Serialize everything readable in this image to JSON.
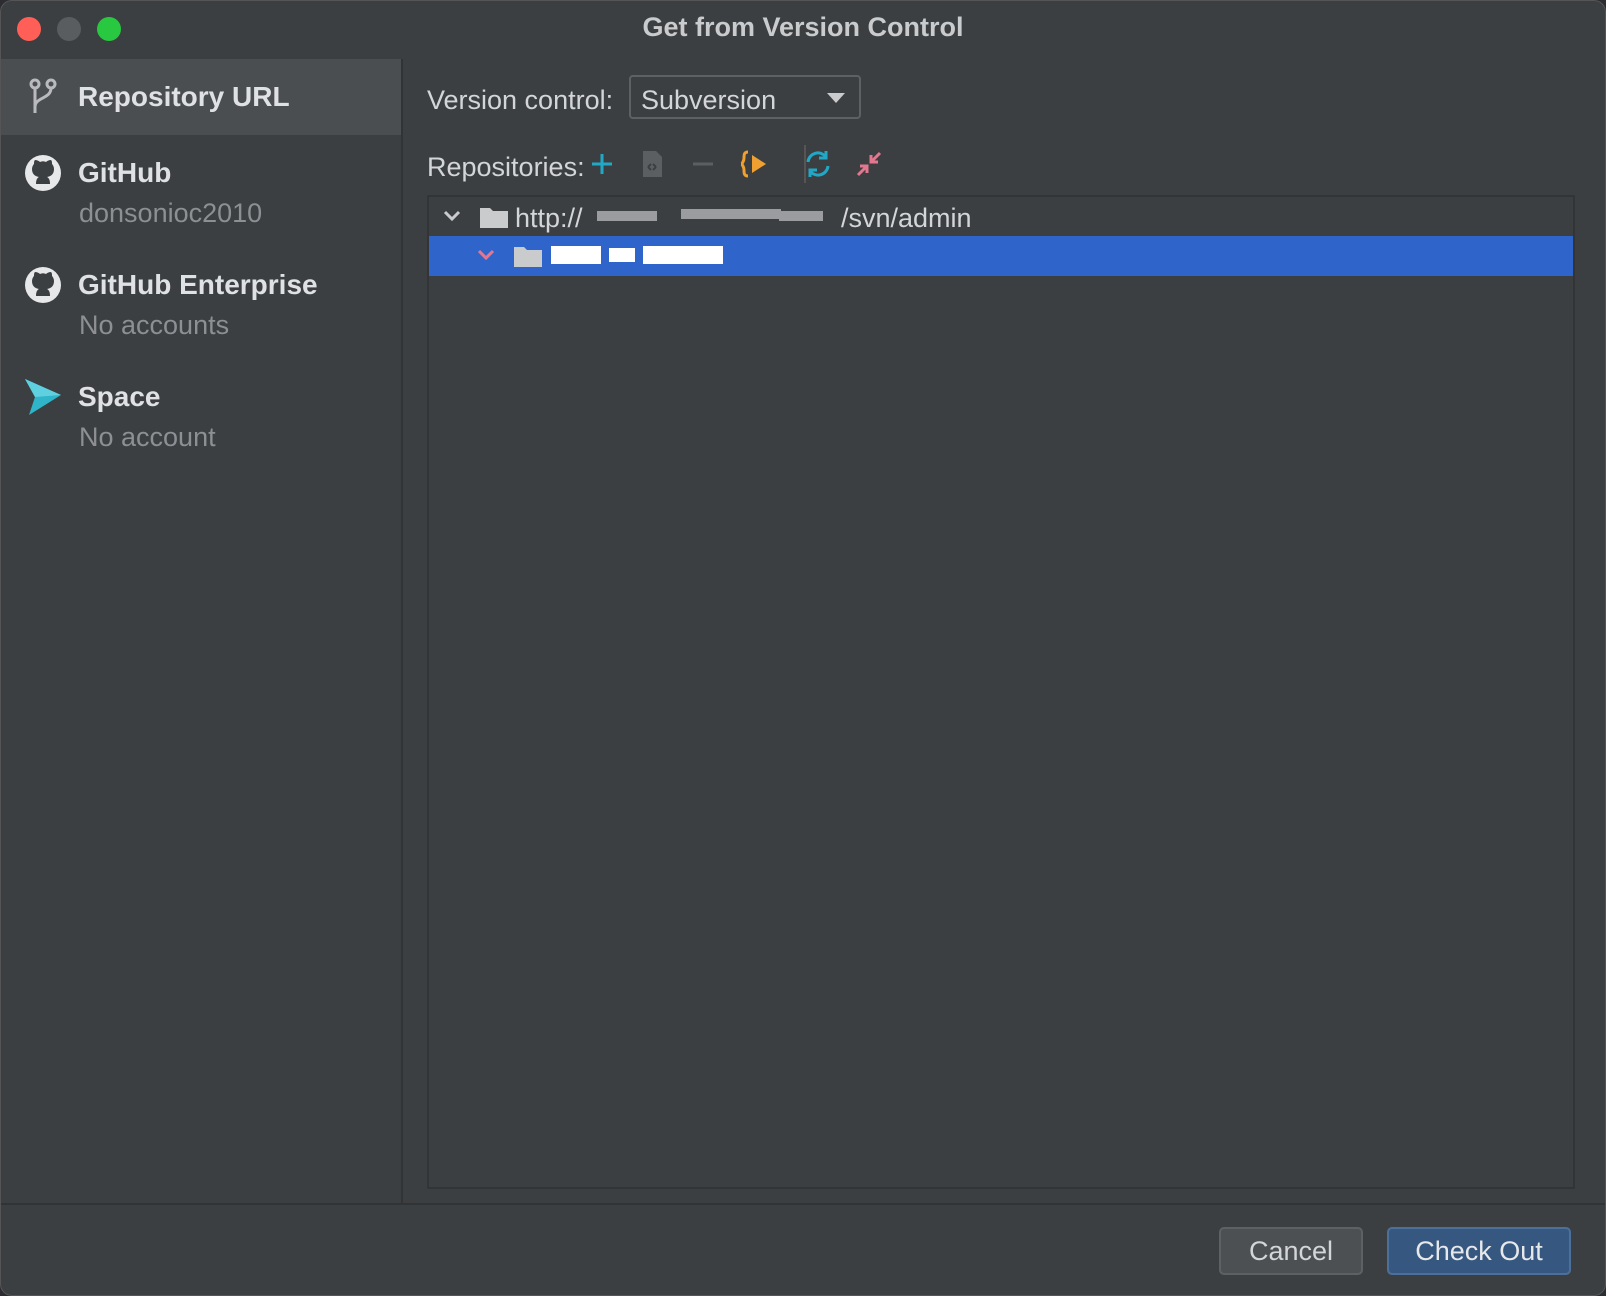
{
  "window": {
    "title": "Get from Version Control"
  },
  "sidebar": {
    "items": [
      {
        "label": "Repository URL",
        "sub": "",
        "icon": "vcs-branch-icon"
      },
      {
        "label": "GitHub",
        "sub": "donsonioc2010",
        "icon": "github-icon"
      },
      {
        "label": "GitHub Enterprise",
        "sub": "No accounts",
        "icon": "github-icon"
      },
      {
        "label": "Space",
        "sub": "No account",
        "icon": "space-icon"
      }
    ]
  },
  "main": {
    "version_control_label": "Version control:",
    "version_control_value": "Subversion",
    "repositories_label": "Repositories:",
    "toolbar": [
      "add-icon",
      "edit-icon",
      "remove-icon",
      "browse-icon",
      "refresh-icon",
      "collapse-icon"
    ],
    "tree": {
      "root_prefix": "http://",
      "root_suffix": "/svn/admin"
    }
  },
  "footer": {
    "cancel_label": "Cancel",
    "ok_label": "Check Out"
  },
  "colors": {
    "selection": "#2f65ca",
    "accent_teal": "#21a8c6",
    "accent_orange": "#f0a030",
    "accent_pink": "#e2778f"
  }
}
